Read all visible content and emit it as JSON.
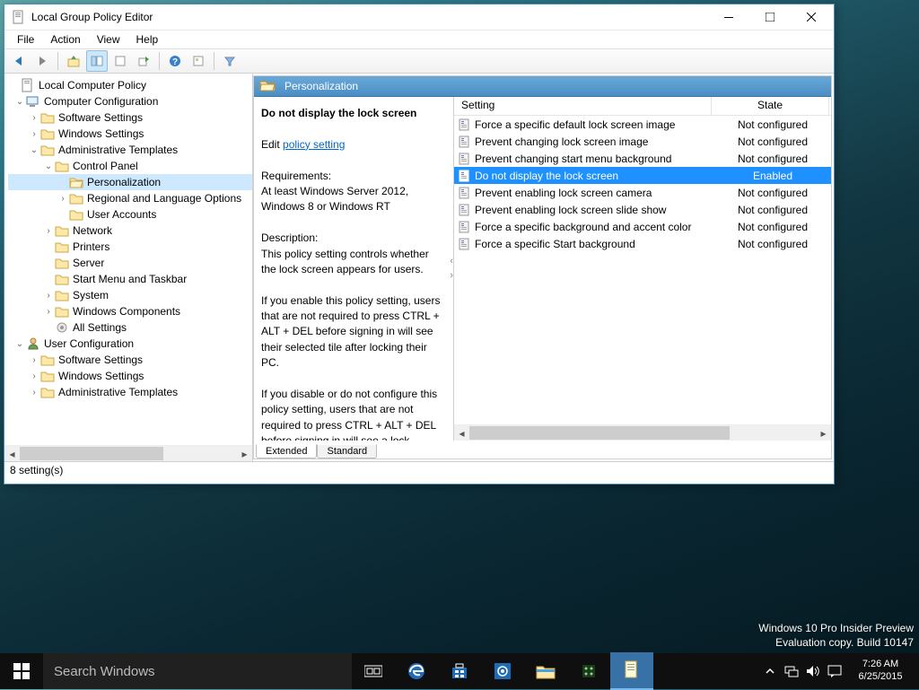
{
  "window": {
    "title": "Local Group Policy Editor",
    "menus": [
      "File",
      "Action",
      "View",
      "Help"
    ],
    "status": "8 setting(s)"
  },
  "tree": {
    "root": "Local Computer Policy",
    "cc": "Computer Configuration",
    "cc_children": {
      "sw": "Software Settings",
      "ws": "Windows Settings",
      "at": "Administrative Templates",
      "cp": "Control Panel",
      "pers": "Personalization",
      "rlo": "Regional and Language Options",
      "ua": "User Accounts",
      "net": "Network",
      "prn": "Printers",
      "srv": "Server",
      "smt": "Start Menu and Taskbar",
      "sys": "System",
      "wc": "Windows Components",
      "all": "All Settings"
    },
    "uc": "User Configuration",
    "uc_children": {
      "sw": "Software Settings",
      "ws": "Windows Settings",
      "at": "Administrative Templates"
    }
  },
  "right": {
    "path": "Personalization",
    "desc": {
      "title": "Do not display the lock screen",
      "edit_prefix": "Edit ",
      "edit_link": "policy setting",
      "req_label": "Requirements:",
      "req_text": "At least Windows Server 2012, Windows 8 or Windows RT",
      "desc_label": "Description:",
      "desc_text": "This policy setting controls whether the lock screen appears for users.",
      "p2": "If you enable this policy setting, users that are not required to press CTRL + ALT + DEL before signing in will see their selected tile after locking their PC.",
      "p3": "If you disable or do not configure this policy setting, users that are not required to press CTRL + ALT + DEL before signing in will see a lock screen after locking their PC."
    },
    "columns": {
      "setting": "Setting",
      "state": "State"
    },
    "rows": [
      {
        "name": "Force a specific default lock screen image",
        "state": "Not configured",
        "sel": false
      },
      {
        "name": "Prevent changing lock screen image",
        "state": "Not configured",
        "sel": false
      },
      {
        "name": "Prevent changing start menu background",
        "state": "Not configured",
        "sel": false
      },
      {
        "name": "Do not display the lock screen",
        "state": "Enabled",
        "sel": true
      },
      {
        "name": "Prevent enabling lock screen camera",
        "state": "Not configured",
        "sel": false
      },
      {
        "name": "Prevent enabling lock screen slide show",
        "state": "Not configured",
        "sel": false
      },
      {
        "name": "Force a specific background and accent color",
        "state": "Not configured",
        "sel": false
      },
      {
        "name": "Force a specific Start background",
        "state": "Not configured",
        "sel": false
      }
    ],
    "tabs": {
      "ext": "Extended",
      "std": "Standard"
    }
  },
  "desktop": {
    "line1": "Windows 10 Pro Insider Preview",
    "line2": "Evaluation copy. Build 10147"
  },
  "taskbar": {
    "search_placeholder": "Search Windows",
    "time": "7:26 AM",
    "date": "6/25/2015"
  }
}
